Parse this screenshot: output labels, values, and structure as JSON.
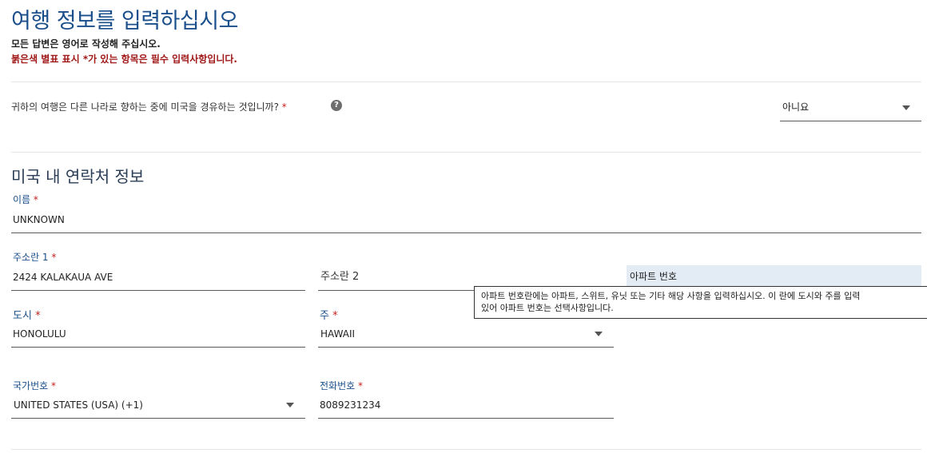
{
  "header": {
    "title": "여행 정보를 입력하십시오",
    "notice": "모든 답변은 영어로 작성해 주십시오.",
    "notice_required": "붉은색 별표 표시 *가 있는 항목은 필수 입력사항입니다."
  },
  "transit": {
    "question": "귀하의 여행은 다른 나라로 향하는 중에 미국을 경유하는 것입니까?",
    "required_mark": "*",
    "help_icon": "?",
    "answer": "아니요"
  },
  "contact": {
    "section_title": "미국 내 연락처 정보",
    "name": {
      "label": "이름",
      "required_mark": "*",
      "value": "UNKNOWN"
    },
    "address1": {
      "label": "주소란 1",
      "required_mark": "*",
      "value": "2424 KALAKAUA AVE"
    },
    "address2": {
      "label": "주소란 2"
    },
    "apartment": {
      "label": "아파트 번호"
    },
    "tooltip": {
      "line1": "아파트 번호란에는 아파트, 스위트, 유닛 또는 기타 해당 사항을 입력하십시오. 이 란에 도시와 주를 입력",
      "line2": "있어 아파트 번호는 선택사항입니다."
    },
    "city": {
      "label": "도시",
      "required_mark": "*",
      "value": "HONOLULU"
    },
    "state": {
      "label": "주",
      "required_mark": "*",
      "value": "HAWAII"
    },
    "country_code": {
      "label": "국가번호",
      "required_mark": "*",
      "value": "UNITED STATES (USA) (+1)"
    },
    "phone": {
      "label": "전화번호",
      "required_mark": "*",
      "value": "8089231234"
    }
  },
  "colors": {
    "title_blue": "#1a4f8b",
    "required_red": "#c81e1e",
    "highlight": "#e3ecf5"
  }
}
